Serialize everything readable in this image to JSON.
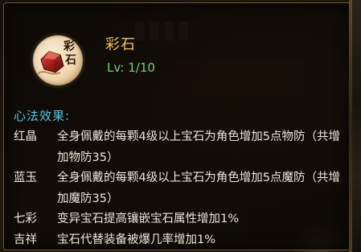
{
  "tooltip": {
    "item_name": "彩石",
    "level": "Lv: 1/10",
    "icon": {
      "name": "colored-stone-skill-icon",
      "chars": [
        "彩",
        "石"
      ]
    },
    "section_title": "心法效果:",
    "effects": [
      {
        "name": "红晶",
        "desc": "全身佩戴的每颗4级以上宝石为角色增加5点物防（共增加物防35）"
      },
      {
        "name": "蓝玉",
        "desc": "全身佩戴的每颗4级以上宝石为角色增加5点魔防（共增加魔防35）"
      },
      {
        "name": "七彩",
        "desc": "变异宝石提高镶嵌宝石属性增加1%"
      },
      {
        "name": "吉祥",
        "desc": "宝石代替装备被爆几率增加1%"
      }
    ]
  },
  "colors": {
    "name": "#f3c63f",
    "level": "#78d06a",
    "section_title": "#4cc5e6",
    "body_text": "#ece6d8",
    "border": "#6b5a3a"
  }
}
